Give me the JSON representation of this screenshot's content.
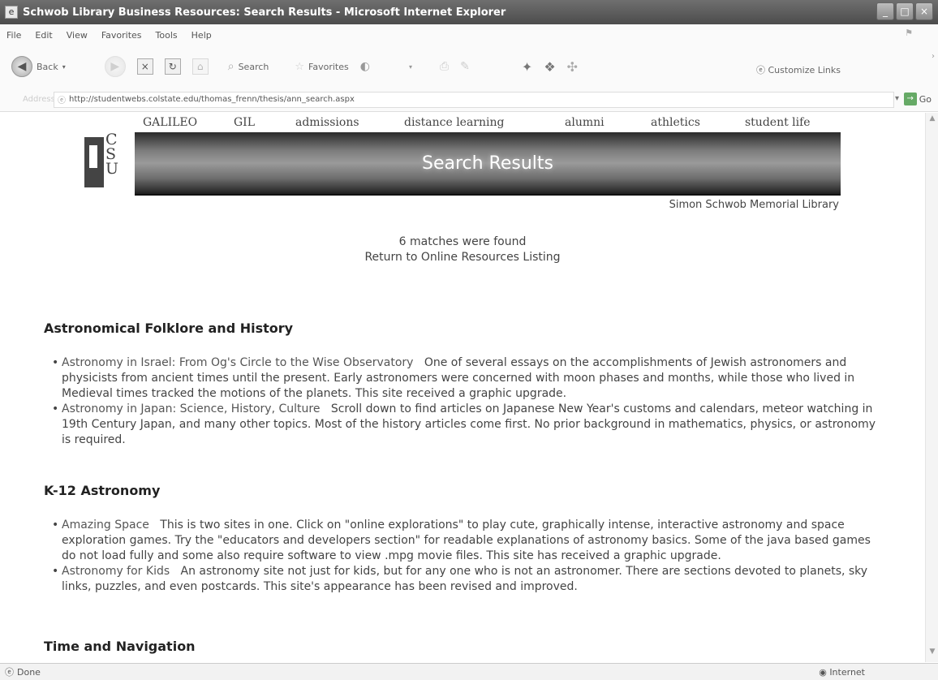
{
  "window": {
    "title": "Schwob Library Business Resources: Search Results - Microsoft Internet Explorer",
    "buttons": [
      "_",
      "□",
      "×"
    ]
  },
  "menu": {
    "items": [
      "File",
      "Edit",
      "View",
      "Favorites",
      "Tools",
      "Help"
    ]
  },
  "toolbar": {
    "back_label": "Back",
    "search_label": "Search",
    "favorites_label": "Favorites",
    "customize_links_label": "Customize Links"
  },
  "address": {
    "label": "Address",
    "url": "http://studentwebs.colstate.edu/thomas_frenn/thesis/ann_search.aspx",
    "go_label": "Go"
  },
  "site": {
    "nav": [
      "GALILEO",
      "GIL",
      "admissions",
      "distance learning",
      "alumni",
      "athletics",
      "student life"
    ],
    "logo_letters": [
      "C",
      "S",
      "U"
    ],
    "banner_title": "Search Results",
    "library_name": "Simon Schwob Memorial Library",
    "match_count_text": "6 matches were found",
    "return_link": "Return to Online Resources Listing"
  },
  "sections": [
    {
      "heading": "Astronomical Folklore and History",
      "items": [
        {
          "link": "Astronomy in Israel: From Og's Circle to the Wise Observatory",
          "desc": "One of several essays on the accomplishments of Jewish astronomers and physicists from ancient times until the present. Early astronomers were concerned with moon phases and months, while those who lived in Medieval times tracked the motions of the planets. This site received a graphic upgrade."
        },
        {
          "link": "Astronomy in Japan: Science, History, Culture",
          "desc": "Scroll down to find articles on Japanese New Year's customs and calendars, meteor watching in 19th Century Japan, and many other topics. Most of the history articles come first. No prior background in mathematics, physics, or astronomy is required."
        }
      ]
    },
    {
      "heading": "K-12 Astronomy",
      "items": [
        {
          "link": "Amazing Space",
          "desc": "This is two sites in one. Click on \"online explorations\" to play cute, graphically intense, interactive astronomy and space exploration games. Try the \"educators and developers section\" for readable explanations of astronomy basics. Some of the java based games do not load fully and some also require software to view .mpg movie files. This site has received a graphic upgrade."
        },
        {
          "link": "Astronomy for Kids",
          "desc": "An astronomy site not just for kids, but for any one who is not an astronomer. There are sections devoted to planets, sky links, puzzles, and even postcards. This site's appearance has been revised and improved."
        }
      ]
    },
    {
      "heading": "Time and Navigation",
      "items": []
    }
  ],
  "status": {
    "left": "Done",
    "zone": "Internet"
  }
}
